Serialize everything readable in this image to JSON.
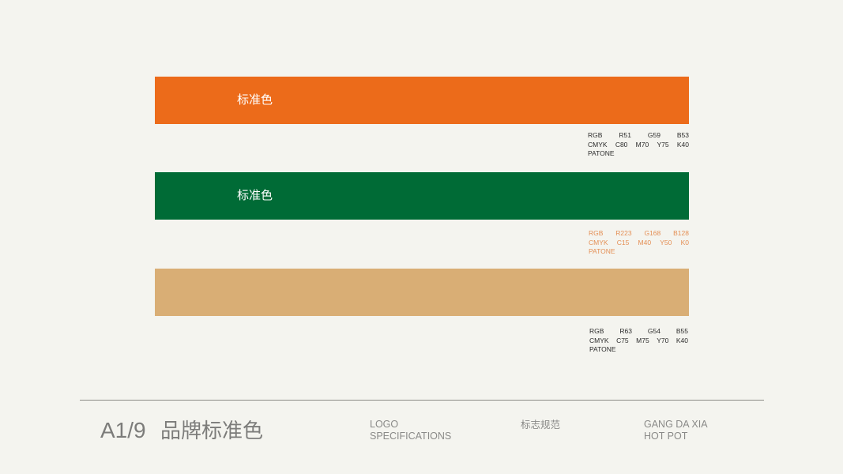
{
  "swatches": [
    {
      "color": "#ec6b1a",
      "label": "标准色",
      "spec_color": "#2c2c2c",
      "rgb": [
        "RGB",
        "R51",
        "G59",
        "B53"
      ],
      "cmyk": [
        "CMYK",
        "C80",
        "M70",
        "Y75",
        "K40"
      ],
      "patone": "PATONE"
    },
    {
      "color": "#006b36",
      "label": "标准色",
      "spec_color": "#e48f55",
      "rgb": [
        "RGB",
        "R223",
        "G168",
        "B128"
      ],
      "cmyk": [
        "CMYK",
        "C15",
        "M40",
        "Y50",
        "K0"
      ],
      "patone": "PATONE"
    },
    {
      "color": "#d9ae75",
      "label": "",
      "spec_color": "#2c2c2c",
      "rgb": [
        "RGB",
        "R63",
        "G54",
        "B55"
      ],
      "cmyk": [
        "CMYK",
        "C75",
        "M75",
        "Y70",
        "K40"
      ],
      "patone": "PATONE"
    }
  ],
  "footer": {
    "page_number": "A1/9",
    "page_title": "品牌标准色",
    "section_en_line1": "LOGO",
    "section_en_line2": "SPECIFICATIONS",
    "section_cn": "标志规范",
    "brand_line1": "GANG DA XIA",
    "brand_line2": "HOT POT"
  }
}
